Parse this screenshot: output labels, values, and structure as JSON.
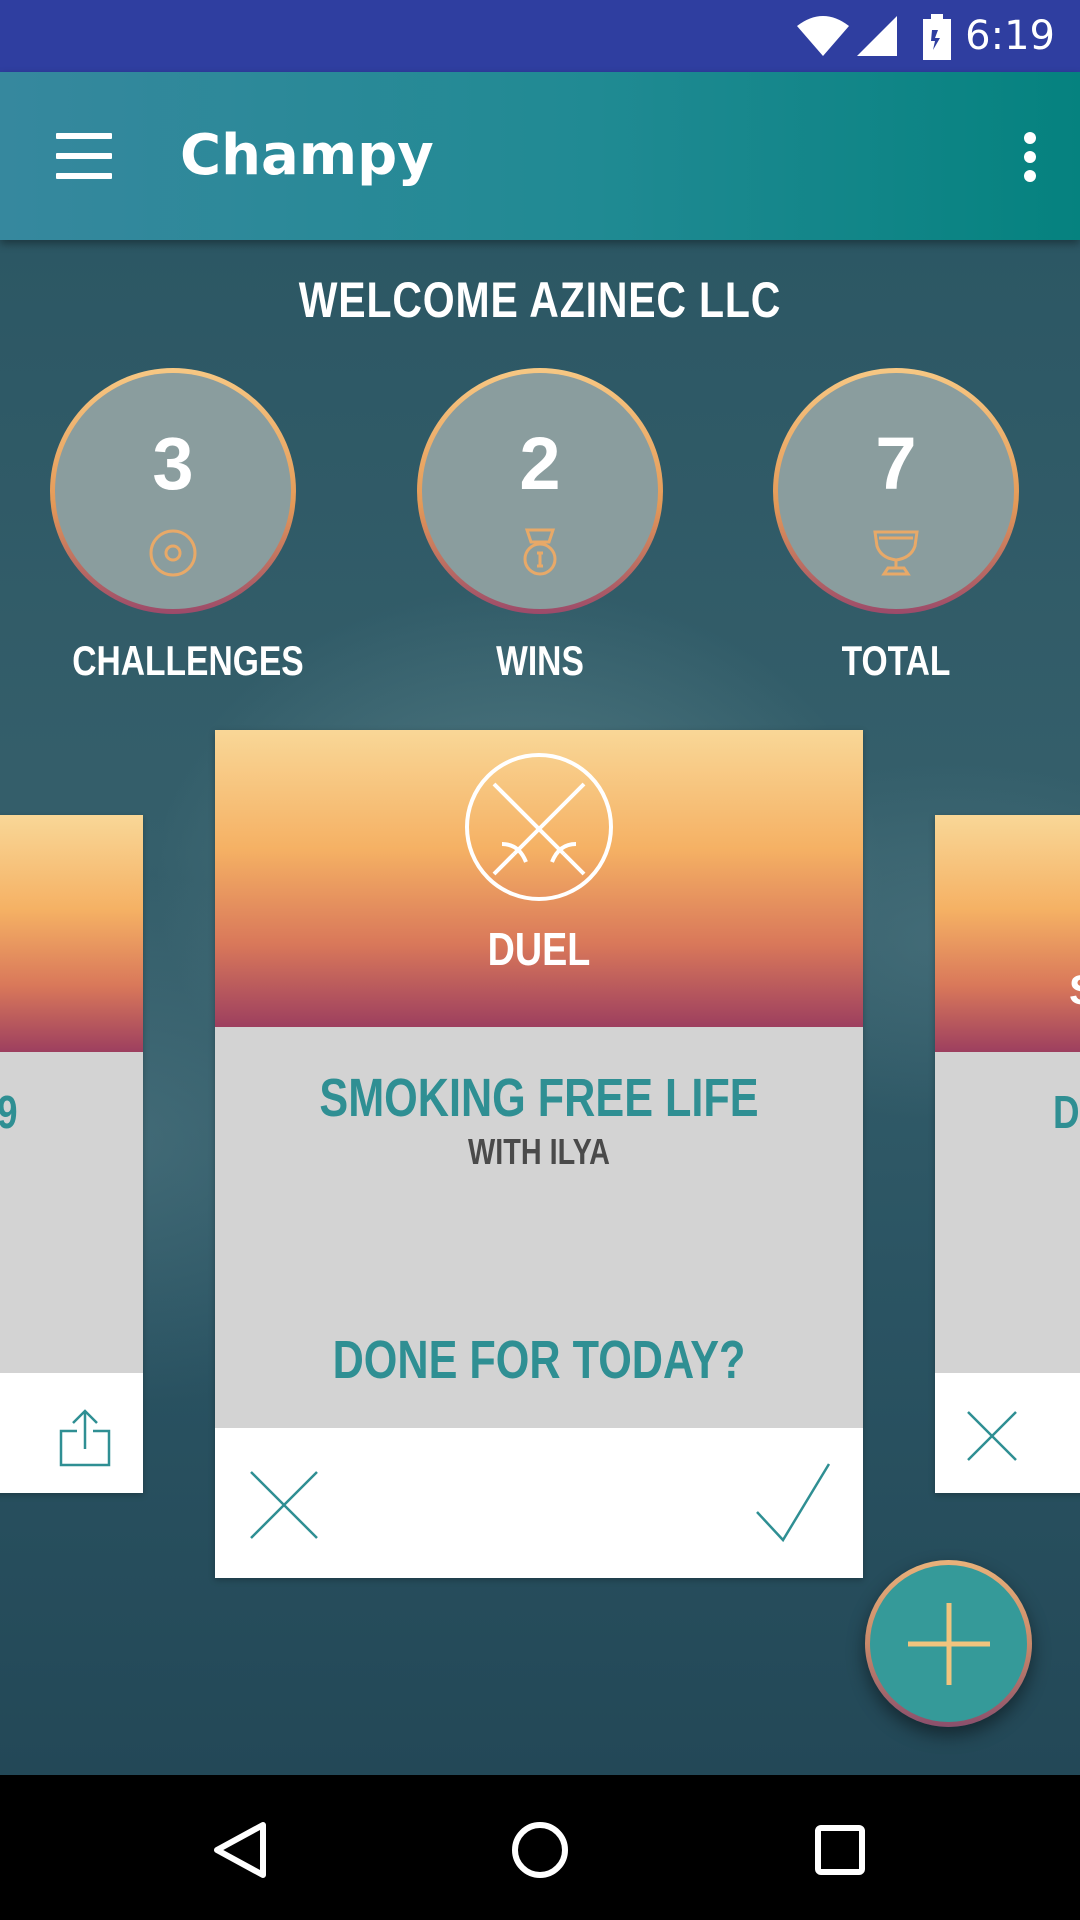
{
  "status_bar": {
    "time": "6:19",
    "icons": [
      "wifi-icon",
      "signal-icon",
      "battery-icon"
    ]
  },
  "app_bar": {
    "title": "Champy",
    "menu_icon": "menu-icon",
    "overflow_icon": "more-vert-icon"
  },
  "welcome": "WELCOME AZINEC LLC",
  "stats": [
    {
      "value": "3",
      "label": "CHALLENGES",
      "icon": "target-icon"
    },
    {
      "value": "2",
      "label": "WINS",
      "icon": "medal-icon"
    },
    {
      "value": "7",
      "label": "TOTAL",
      "icon": "trophy-icon"
    }
  ],
  "main_card": {
    "type_label": "DUEL",
    "type_icon": "crossed-swords-icon",
    "title": "SMOKING FREE LIFE",
    "partner": "WITH ILYA",
    "question": "DONE FOR TODAY?",
    "decline_icon": "close-icon",
    "accept_icon": "check-icon"
  },
  "left_card": {
    "partial_text": "9",
    "action_icon": "share-icon"
  },
  "right_card": {
    "partial_header_text": "S",
    "partial_text": "DI",
    "action_icon": "close-icon"
  },
  "fab": {
    "icon": "plus-icon"
  },
  "nav_bar": {
    "icons": [
      "back-icon",
      "home-icon",
      "recents-icon"
    ]
  },
  "colors": {
    "status_bar": "#2f3ea0",
    "app_bar_start": "#36889e",
    "app_bar_end": "#05827f",
    "accent_teal": "#2f8f93",
    "card_gradient_top": "#f9d797",
    "card_gradient_bottom": "#9d3f5f"
  }
}
